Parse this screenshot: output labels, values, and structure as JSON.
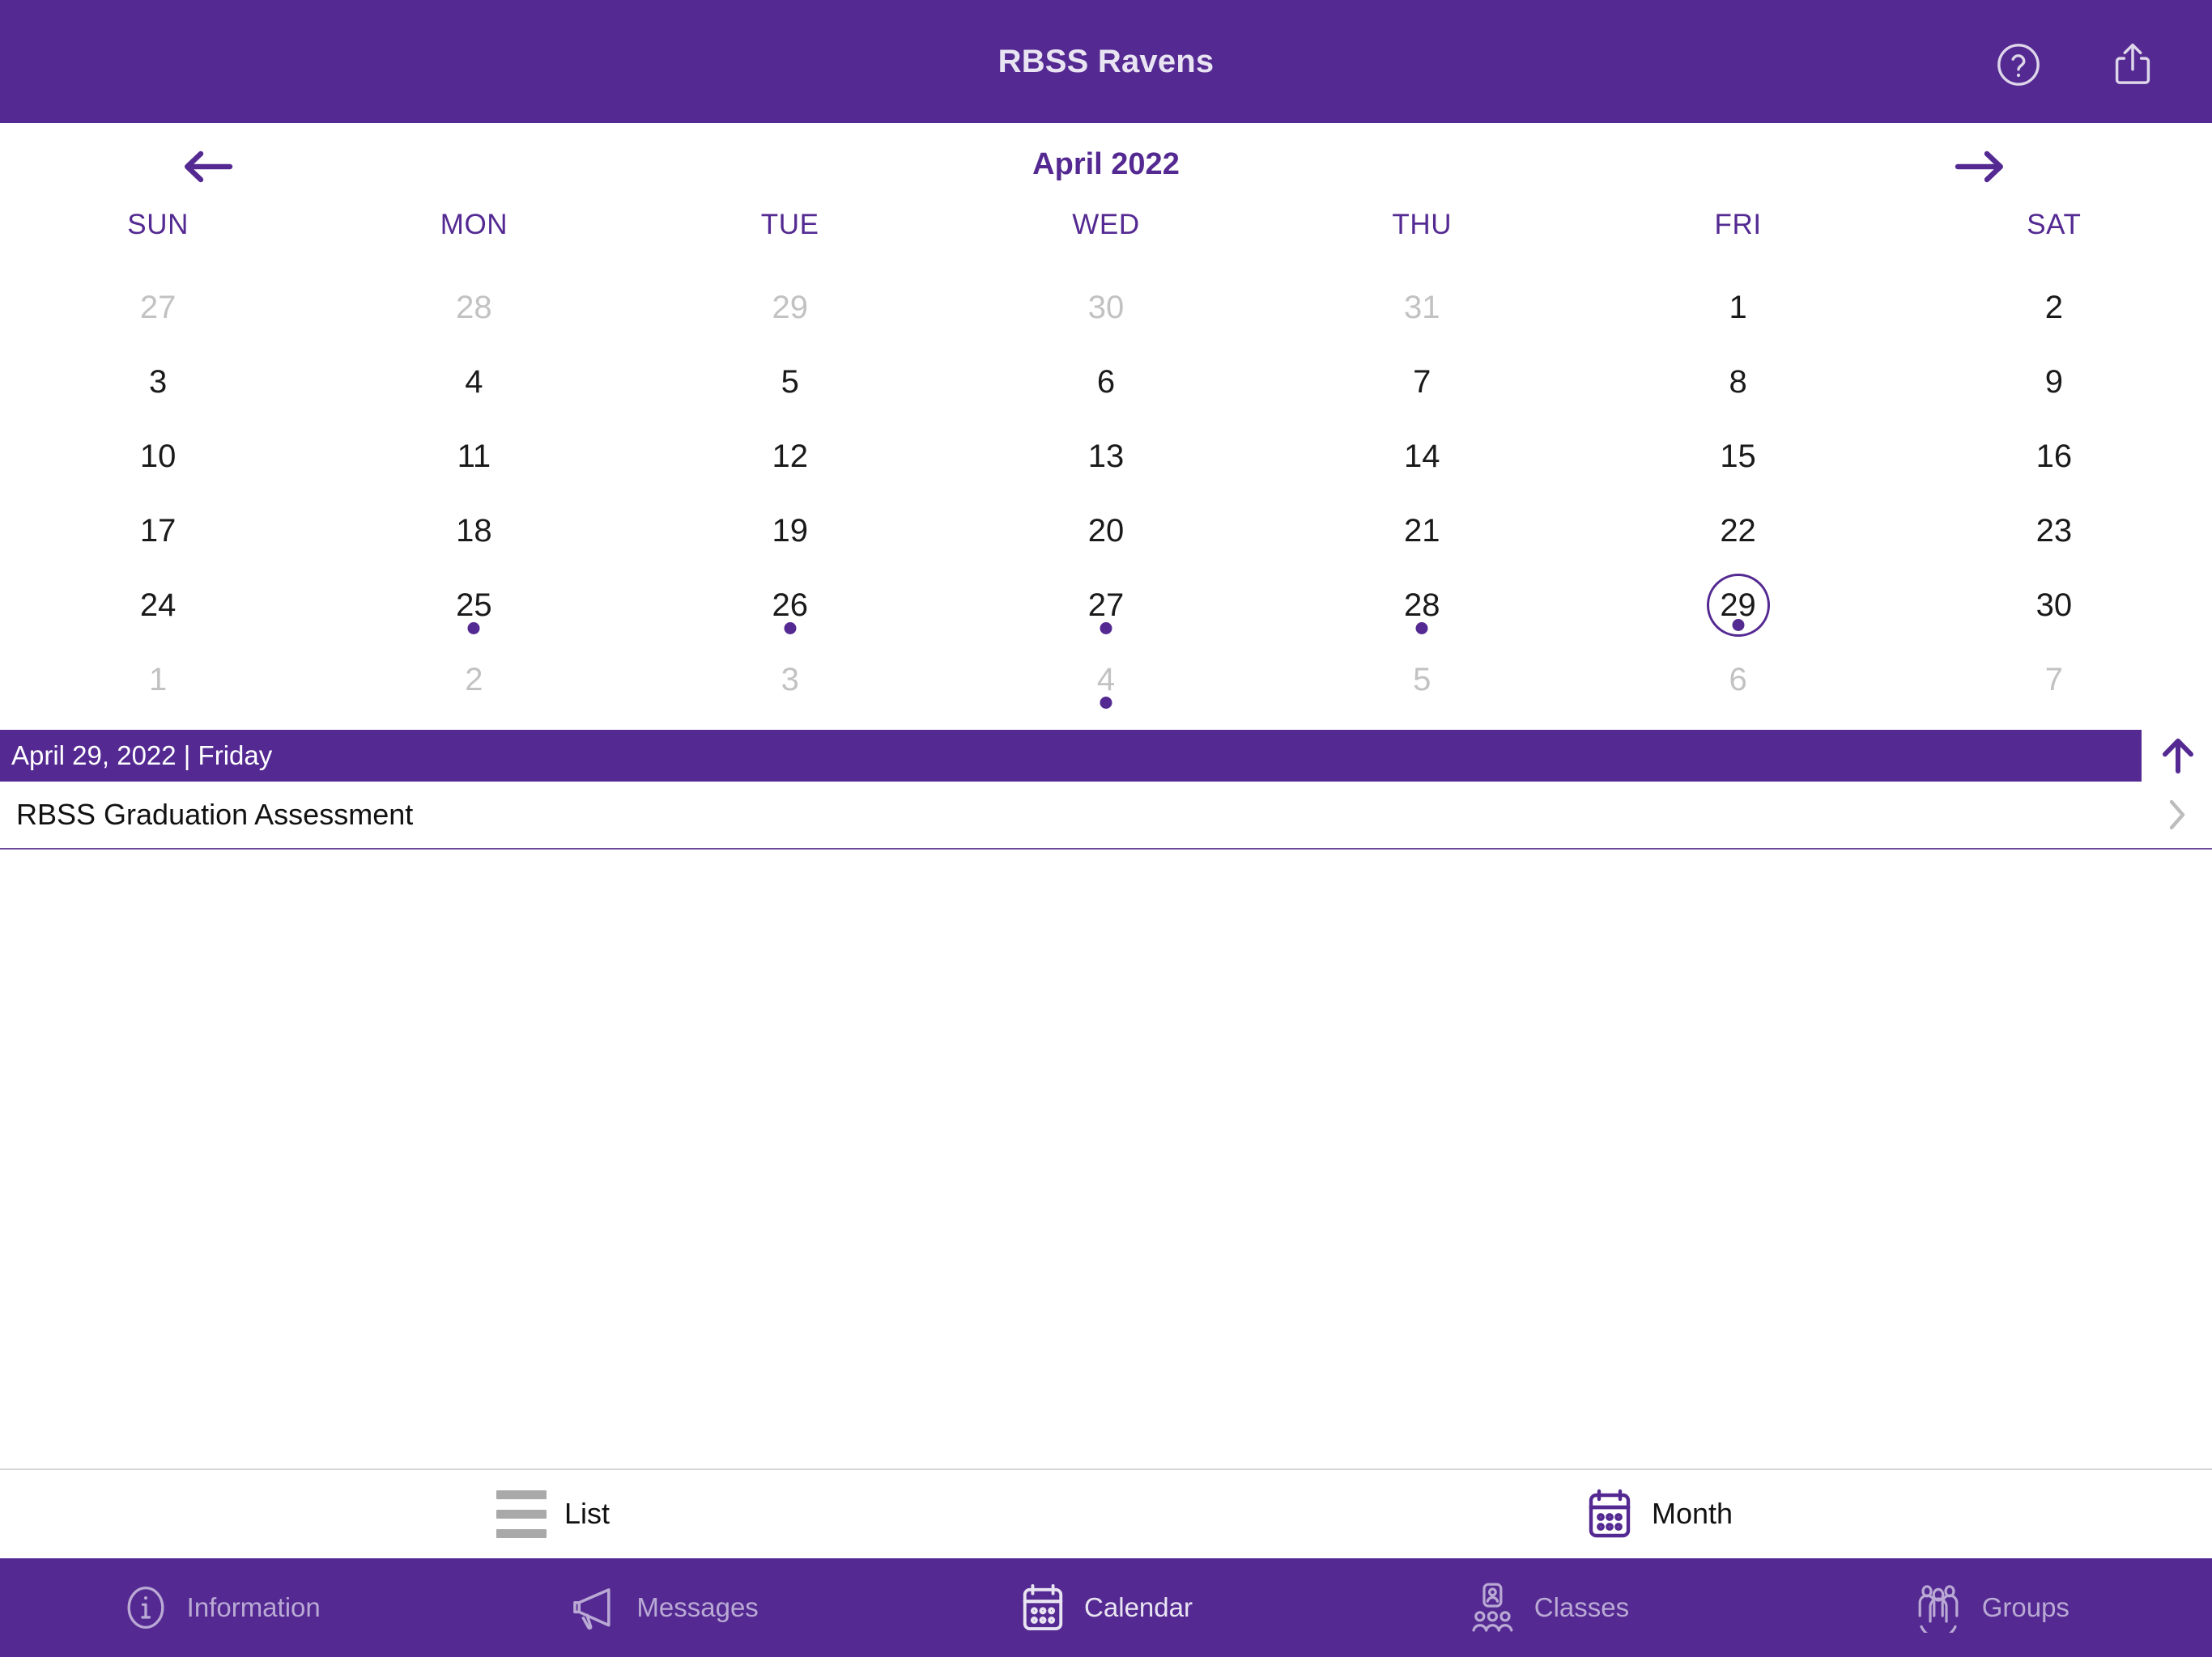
{
  "header": {
    "title": "RBSS Ravens",
    "help_icon": "help-circle-icon",
    "share_icon": "share-icon"
  },
  "calendar": {
    "month_label": "April 2022",
    "prev_icon": "arrow-left-icon",
    "next_icon": "arrow-right-icon",
    "weekdays": [
      "SUN",
      "MON",
      "TUE",
      "WED",
      "THU",
      "FRI",
      "SAT"
    ],
    "weeks": [
      [
        {
          "d": "27",
          "muted": true,
          "dot": false,
          "selected": false
        },
        {
          "d": "28",
          "muted": true,
          "dot": false,
          "selected": false
        },
        {
          "d": "29",
          "muted": true,
          "dot": false,
          "selected": false
        },
        {
          "d": "30",
          "muted": true,
          "dot": false,
          "selected": false
        },
        {
          "d": "31",
          "muted": true,
          "dot": false,
          "selected": false
        },
        {
          "d": "1",
          "muted": false,
          "dot": false,
          "selected": false
        },
        {
          "d": "2",
          "muted": false,
          "dot": false,
          "selected": false
        }
      ],
      [
        {
          "d": "3",
          "muted": false,
          "dot": false,
          "selected": false
        },
        {
          "d": "4",
          "muted": false,
          "dot": false,
          "selected": false
        },
        {
          "d": "5",
          "muted": false,
          "dot": false,
          "selected": false
        },
        {
          "d": "6",
          "muted": false,
          "dot": false,
          "selected": false
        },
        {
          "d": "7",
          "muted": false,
          "dot": false,
          "selected": false
        },
        {
          "d": "8",
          "muted": false,
          "dot": false,
          "selected": false
        },
        {
          "d": "9",
          "muted": false,
          "dot": false,
          "selected": false
        }
      ],
      [
        {
          "d": "10",
          "muted": false,
          "dot": false,
          "selected": false
        },
        {
          "d": "11",
          "muted": false,
          "dot": false,
          "selected": false
        },
        {
          "d": "12",
          "muted": false,
          "dot": false,
          "selected": false
        },
        {
          "d": "13",
          "muted": false,
          "dot": false,
          "selected": false
        },
        {
          "d": "14",
          "muted": false,
          "dot": false,
          "selected": false
        },
        {
          "d": "15",
          "muted": false,
          "dot": false,
          "selected": false
        },
        {
          "d": "16",
          "muted": false,
          "dot": false,
          "selected": false
        }
      ],
      [
        {
          "d": "17",
          "muted": false,
          "dot": false,
          "selected": false
        },
        {
          "d": "18",
          "muted": false,
          "dot": false,
          "selected": false
        },
        {
          "d": "19",
          "muted": false,
          "dot": false,
          "selected": false
        },
        {
          "d": "20",
          "muted": false,
          "dot": false,
          "selected": false
        },
        {
          "d": "21",
          "muted": false,
          "dot": false,
          "selected": false
        },
        {
          "d": "22",
          "muted": false,
          "dot": false,
          "selected": false
        },
        {
          "d": "23",
          "muted": false,
          "dot": false,
          "selected": false
        }
      ],
      [
        {
          "d": "24",
          "muted": false,
          "dot": false,
          "selected": false
        },
        {
          "d": "25",
          "muted": false,
          "dot": true,
          "selected": false
        },
        {
          "d": "26",
          "muted": false,
          "dot": true,
          "selected": false
        },
        {
          "d": "27",
          "muted": false,
          "dot": true,
          "selected": false
        },
        {
          "d": "28",
          "muted": false,
          "dot": true,
          "selected": false
        },
        {
          "d": "29",
          "muted": false,
          "dot": true,
          "selected": true
        },
        {
          "d": "30",
          "muted": false,
          "dot": false,
          "selected": false
        }
      ],
      [
        {
          "d": "1",
          "muted": true,
          "dot": false,
          "selected": false
        },
        {
          "d": "2",
          "muted": true,
          "dot": false,
          "selected": false
        },
        {
          "d": "3",
          "muted": true,
          "dot": false,
          "selected": false
        },
        {
          "d": "4",
          "muted": true,
          "dot": true,
          "selected": false
        },
        {
          "d": "5",
          "muted": true,
          "dot": false,
          "selected": false
        },
        {
          "d": "6",
          "muted": true,
          "dot": false,
          "selected": false
        },
        {
          "d": "7",
          "muted": true,
          "dot": false,
          "selected": false
        }
      ]
    ]
  },
  "selected_day": {
    "banner_text": "April 29, 2022 | Friday",
    "collapse_icon": "arrow-up-icon",
    "events": [
      {
        "title": "RBSS Graduation Assessment",
        "chevron_icon": "chevron-right-icon"
      }
    ]
  },
  "view_switcher": {
    "options": [
      {
        "label": "List",
        "icon": "list-icon",
        "active": false
      },
      {
        "label": "Month",
        "icon": "calendar-icon",
        "active": true
      }
    ]
  },
  "tabbar": {
    "tabs": [
      {
        "label": "Information",
        "icon": "info-circle-icon",
        "active": false
      },
      {
        "label": "Messages",
        "icon": "megaphone-icon",
        "active": false
      },
      {
        "label": "Calendar",
        "icon": "calendar-icon",
        "active": true
      },
      {
        "label": "Classes",
        "icon": "classes-icon",
        "active": false
      },
      {
        "label": "Groups",
        "icon": "groups-icon",
        "active": false
      }
    ]
  },
  "colors": {
    "brand_purple": "#542A92",
    "banner_text": "#FFFFFF",
    "muted_day": "#C2C2C2",
    "inactive_tab": "#B9A9D4"
  }
}
